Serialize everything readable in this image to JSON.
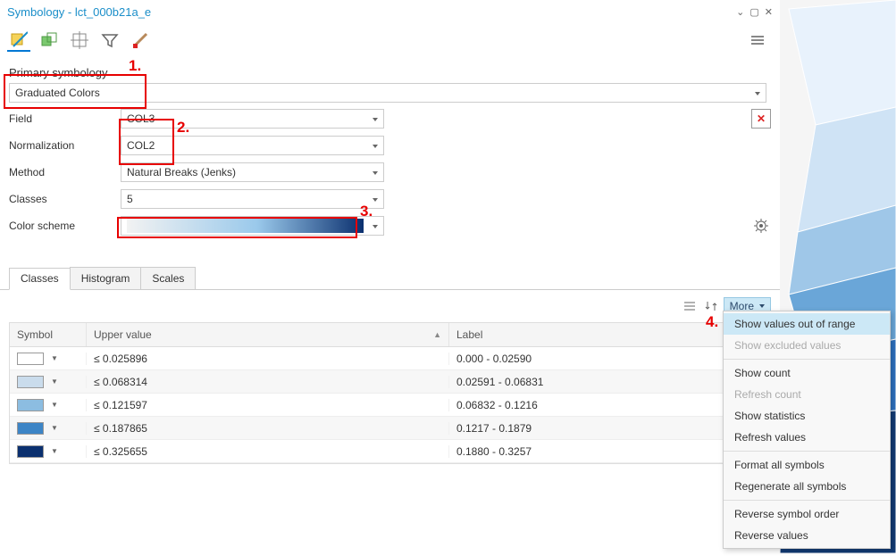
{
  "title": "Symbology - lct_000b21a_e",
  "primary": {
    "section_label": "Primary symbology",
    "value": "Graduated Colors"
  },
  "fields": {
    "field_label": "Field",
    "field_value": "COL3",
    "norm_label": "Normalization",
    "norm_value": "COL2",
    "method_label": "Method",
    "method_value": "Natural Breaks (Jenks)",
    "classes_label": "Classes",
    "classes_value": "5",
    "scheme_label": "Color scheme"
  },
  "color_ramp": {
    "start": "#f2f2f2",
    "mid": "#9ac9eb",
    "end": "#0b306f"
  },
  "tabs": {
    "classes": "Classes",
    "histogram": "Histogram",
    "scales": "Scales"
  },
  "more_label": "More",
  "grid": {
    "headers": {
      "symbol": "Symbol",
      "upper": "Upper value",
      "label": "Label"
    },
    "rows": [
      {
        "color": "#ffffff",
        "upper": "≤    0.025896",
        "label": "0.000 - 0.02590"
      },
      {
        "color": "#cadcec",
        "upper": "≤    0.068314",
        "label": "0.02591 - 0.06831"
      },
      {
        "color": "#8cbde1",
        "upper": "≤    0.121597",
        "label": "0.06832 - 0.1216"
      },
      {
        "color": "#3d85c6",
        "upper": "≤    0.187865",
        "label": "0.1217 - 0.1879"
      },
      {
        "color": "#0b306f",
        "upper": "≤    0.325655",
        "label": "0.1880 - 0.3257"
      }
    ]
  },
  "menu": {
    "show_out_of_range": "Show values out of range",
    "show_excluded": "Show excluded values",
    "show_count": "Show count",
    "refresh_count": "Refresh count",
    "show_stats": "Show statistics",
    "refresh_values": "Refresh values",
    "format_all": "Format all symbols",
    "regen_all": "Regenerate all symbols",
    "reverse_order": "Reverse symbol order",
    "reverse_values": "Reverse values"
  },
  "annot": {
    "a1": "1.",
    "a2": "2.",
    "a3": "3.",
    "a4": "4."
  }
}
